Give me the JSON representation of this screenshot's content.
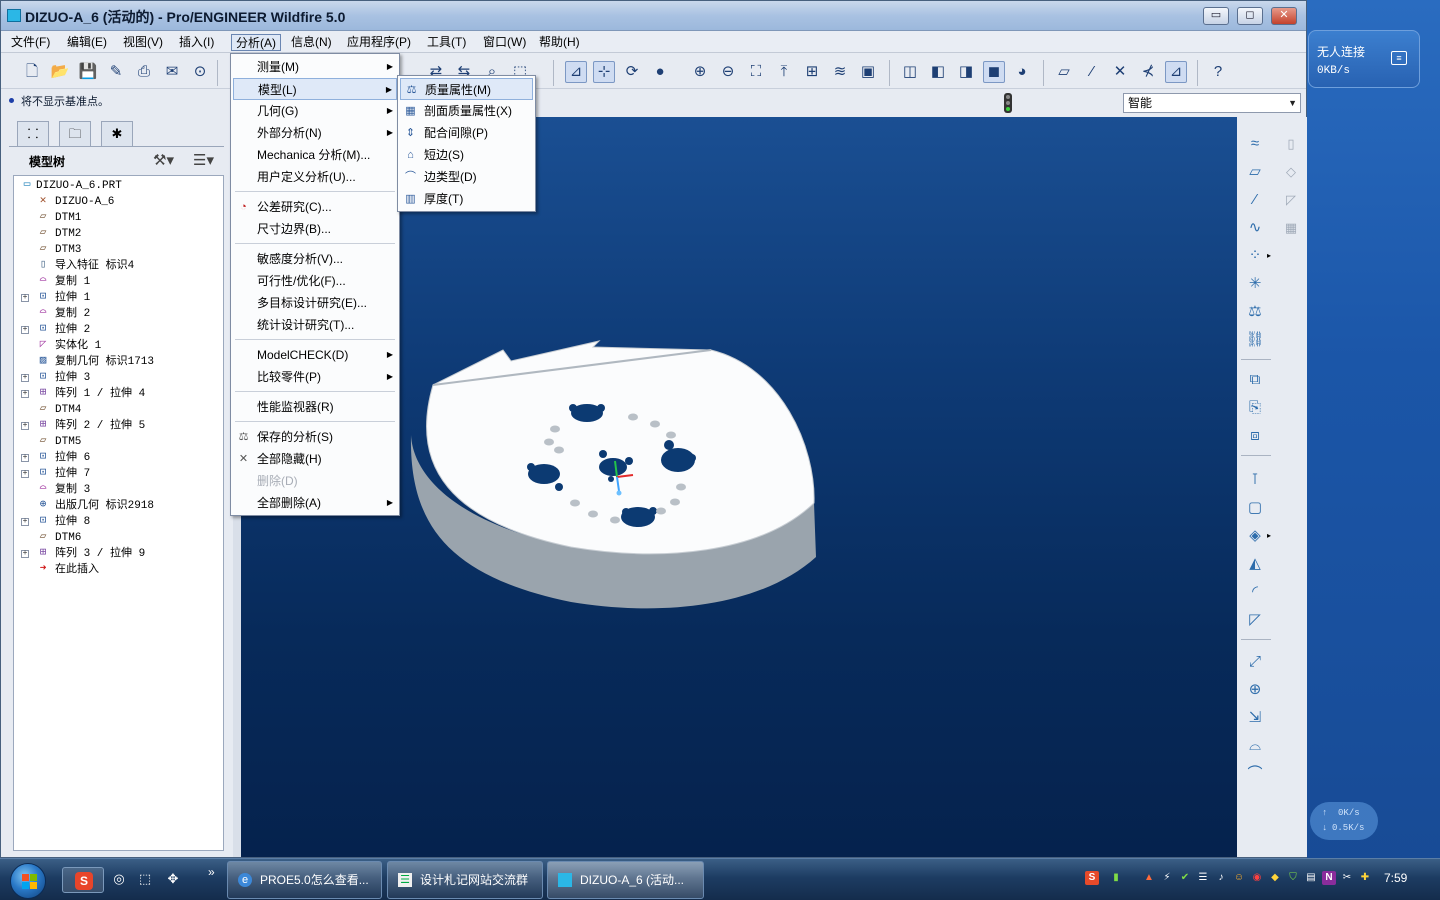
{
  "window": {
    "title": "DIZUO-A_6 (活动的) - Pro/ENGINEER Wildfire 5.0",
    "minimize": "▭",
    "maximize": "◻",
    "close": "✕"
  },
  "menubar": [
    "文件(F)",
    "编辑(E)",
    "视图(V)",
    "插入(I)",
    "分析(A)",
    "信息(N)",
    "应用程序(P)",
    "工具(T)",
    "窗口(W)",
    "帮助(H)"
  ],
  "status": {
    "message": "将不显示基准点。",
    "filter_value": "智能"
  },
  "left_panel": {
    "tree_title": "模型树",
    "tree_items": [
      {
        "label": "DIZUO-A_6.PRT",
        "icon": "part-icon",
        "expandable": false
      },
      {
        "label": "DIZUO-A_6",
        "icon": "csys-icon",
        "expandable": false
      },
      {
        "label": "DTM1",
        "icon": "datum-plane-icon",
        "expandable": false
      },
      {
        "label": "DTM2",
        "icon": "datum-plane-icon",
        "expandable": false
      },
      {
        "label": "DTM3",
        "icon": "datum-plane-icon",
        "expandable": false
      },
      {
        "label": "导入特征 标识4",
        "icon": "import-feature-icon",
        "expandable": false
      },
      {
        "label": "复制 1",
        "icon": "copy-icon",
        "expandable": false
      },
      {
        "label": "拉伸 1",
        "icon": "extrude-icon",
        "expandable": true
      },
      {
        "label": "复制 2",
        "icon": "copy-icon",
        "expandable": false
      },
      {
        "label": "拉伸 2",
        "icon": "extrude-icon",
        "expandable": true
      },
      {
        "label": "实体化 1",
        "icon": "solidify-icon",
        "expandable": false
      },
      {
        "label": "复制几何 标识1713",
        "icon": "copy-geometry-icon",
        "expandable": false
      },
      {
        "label": "拉伸 3",
        "icon": "extrude-icon",
        "expandable": true
      },
      {
        "label": "阵列 1 / 拉伸 4",
        "icon": "pattern-icon",
        "expandable": true
      },
      {
        "label": "DTM4",
        "icon": "datum-plane-icon",
        "expandable": false
      },
      {
        "label": "阵列 2 / 拉伸 5",
        "icon": "pattern-icon",
        "expandable": true
      },
      {
        "label": "DTM5",
        "icon": "datum-plane-icon",
        "expandable": false
      },
      {
        "label": "拉伸 6",
        "icon": "extrude-icon",
        "expandable": true
      },
      {
        "label": "拉伸 7",
        "icon": "extrude-icon",
        "expandable": true
      },
      {
        "label": "复制 3",
        "icon": "copy-icon",
        "expandable": false
      },
      {
        "label": "出版几何 标识2918",
        "icon": "publish-geometry-icon",
        "expandable": false
      },
      {
        "label": "拉伸 8",
        "icon": "extrude-icon",
        "expandable": true
      },
      {
        "label": "DTM6",
        "icon": "datum-plane-icon",
        "expandable": false
      },
      {
        "label": "阵列 3 / 拉伸 9",
        "icon": "pattern-icon",
        "expandable": true
      },
      {
        "label": "在此插入",
        "icon": "insert-here-arrow-icon",
        "expandable": false
      }
    ]
  },
  "analysis_menu": [
    {
      "label": "测量(M)",
      "submenu": true,
      "icon": ""
    },
    {
      "label": "模型(L)",
      "submenu": true,
      "icon": "",
      "highlight": true
    },
    {
      "label": "几何(G)",
      "submenu": true,
      "icon": ""
    },
    {
      "label": "外部分析(N)",
      "submenu": true,
      "icon": ""
    },
    {
      "label": "Mechanica 分析(M)...",
      "submenu": false,
      "icon": ""
    },
    {
      "label": "用户定义分析(U)...",
      "submenu": false,
      "icon": ""
    },
    {
      "sep": true
    },
    {
      "label": "公差研究(C)...",
      "submenu": false,
      "icon": "tolerance-icon"
    },
    {
      "label": "尺寸边界(B)...",
      "submenu": false,
      "icon": ""
    },
    {
      "sep": true
    },
    {
      "label": "敏感度分析(V)...",
      "submenu": false,
      "icon": ""
    },
    {
      "label": "可行性/优化(F)...",
      "submenu": false,
      "icon": ""
    },
    {
      "label": "多目标设计研究(E)...",
      "submenu": false,
      "icon": ""
    },
    {
      "label": "统计设计研究(T)...",
      "submenu": false,
      "icon": ""
    },
    {
      "sep": true
    },
    {
      "label": "ModelCHECK(D)",
      "submenu": true,
      "icon": ""
    },
    {
      "label": "比较零件(P)",
      "submenu": true,
      "icon": ""
    },
    {
      "sep": true
    },
    {
      "label": "性能监视器(R)",
      "submenu": false,
      "icon": ""
    },
    {
      "sep": true
    },
    {
      "label": "保存的分析(S)",
      "submenu": false,
      "icon": "saved-analysis-icon"
    },
    {
      "label": "全部隐藏(H)",
      "submenu": false,
      "icon": "hide-all-icon"
    },
    {
      "label": "删除(D)",
      "submenu": false,
      "icon": "",
      "disabled": true
    },
    {
      "label": "全部删除(A)",
      "submenu": true,
      "icon": ""
    }
  ],
  "model_submenu": [
    {
      "label": "质量属性(M)",
      "icon": "mass-properties-icon",
      "highlight": true
    },
    {
      "label": "剖面质量属性(X)",
      "icon": "xsection-mass-icon"
    },
    {
      "label": "配合间隙(P)",
      "icon": "clearance-icon"
    },
    {
      "label": "短边(S)",
      "icon": "short-edge-icon"
    },
    {
      "label": "边类型(D)",
      "icon": "edge-type-icon"
    },
    {
      "label": "厚度(T)",
      "icon": "thickness-icon"
    }
  ],
  "net_widget": {
    "title": "无人连接",
    "speed": "0KB/s",
    "up": "0K/s",
    "down": "0.5K/s"
  },
  "taskbar": {
    "tasks": [
      {
        "label": "PROE5.0怎么查看...",
        "icon": "ie-icon"
      },
      {
        "label": "设计札记网站交流群",
        "icon": "chat-icon"
      },
      {
        "label": "DIZUO-A_6 (活动...",
        "icon": "proe-icon",
        "active": true
      }
    ],
    "clock": "7:59",
    "quicklaunch_more": "»"
  }
}
